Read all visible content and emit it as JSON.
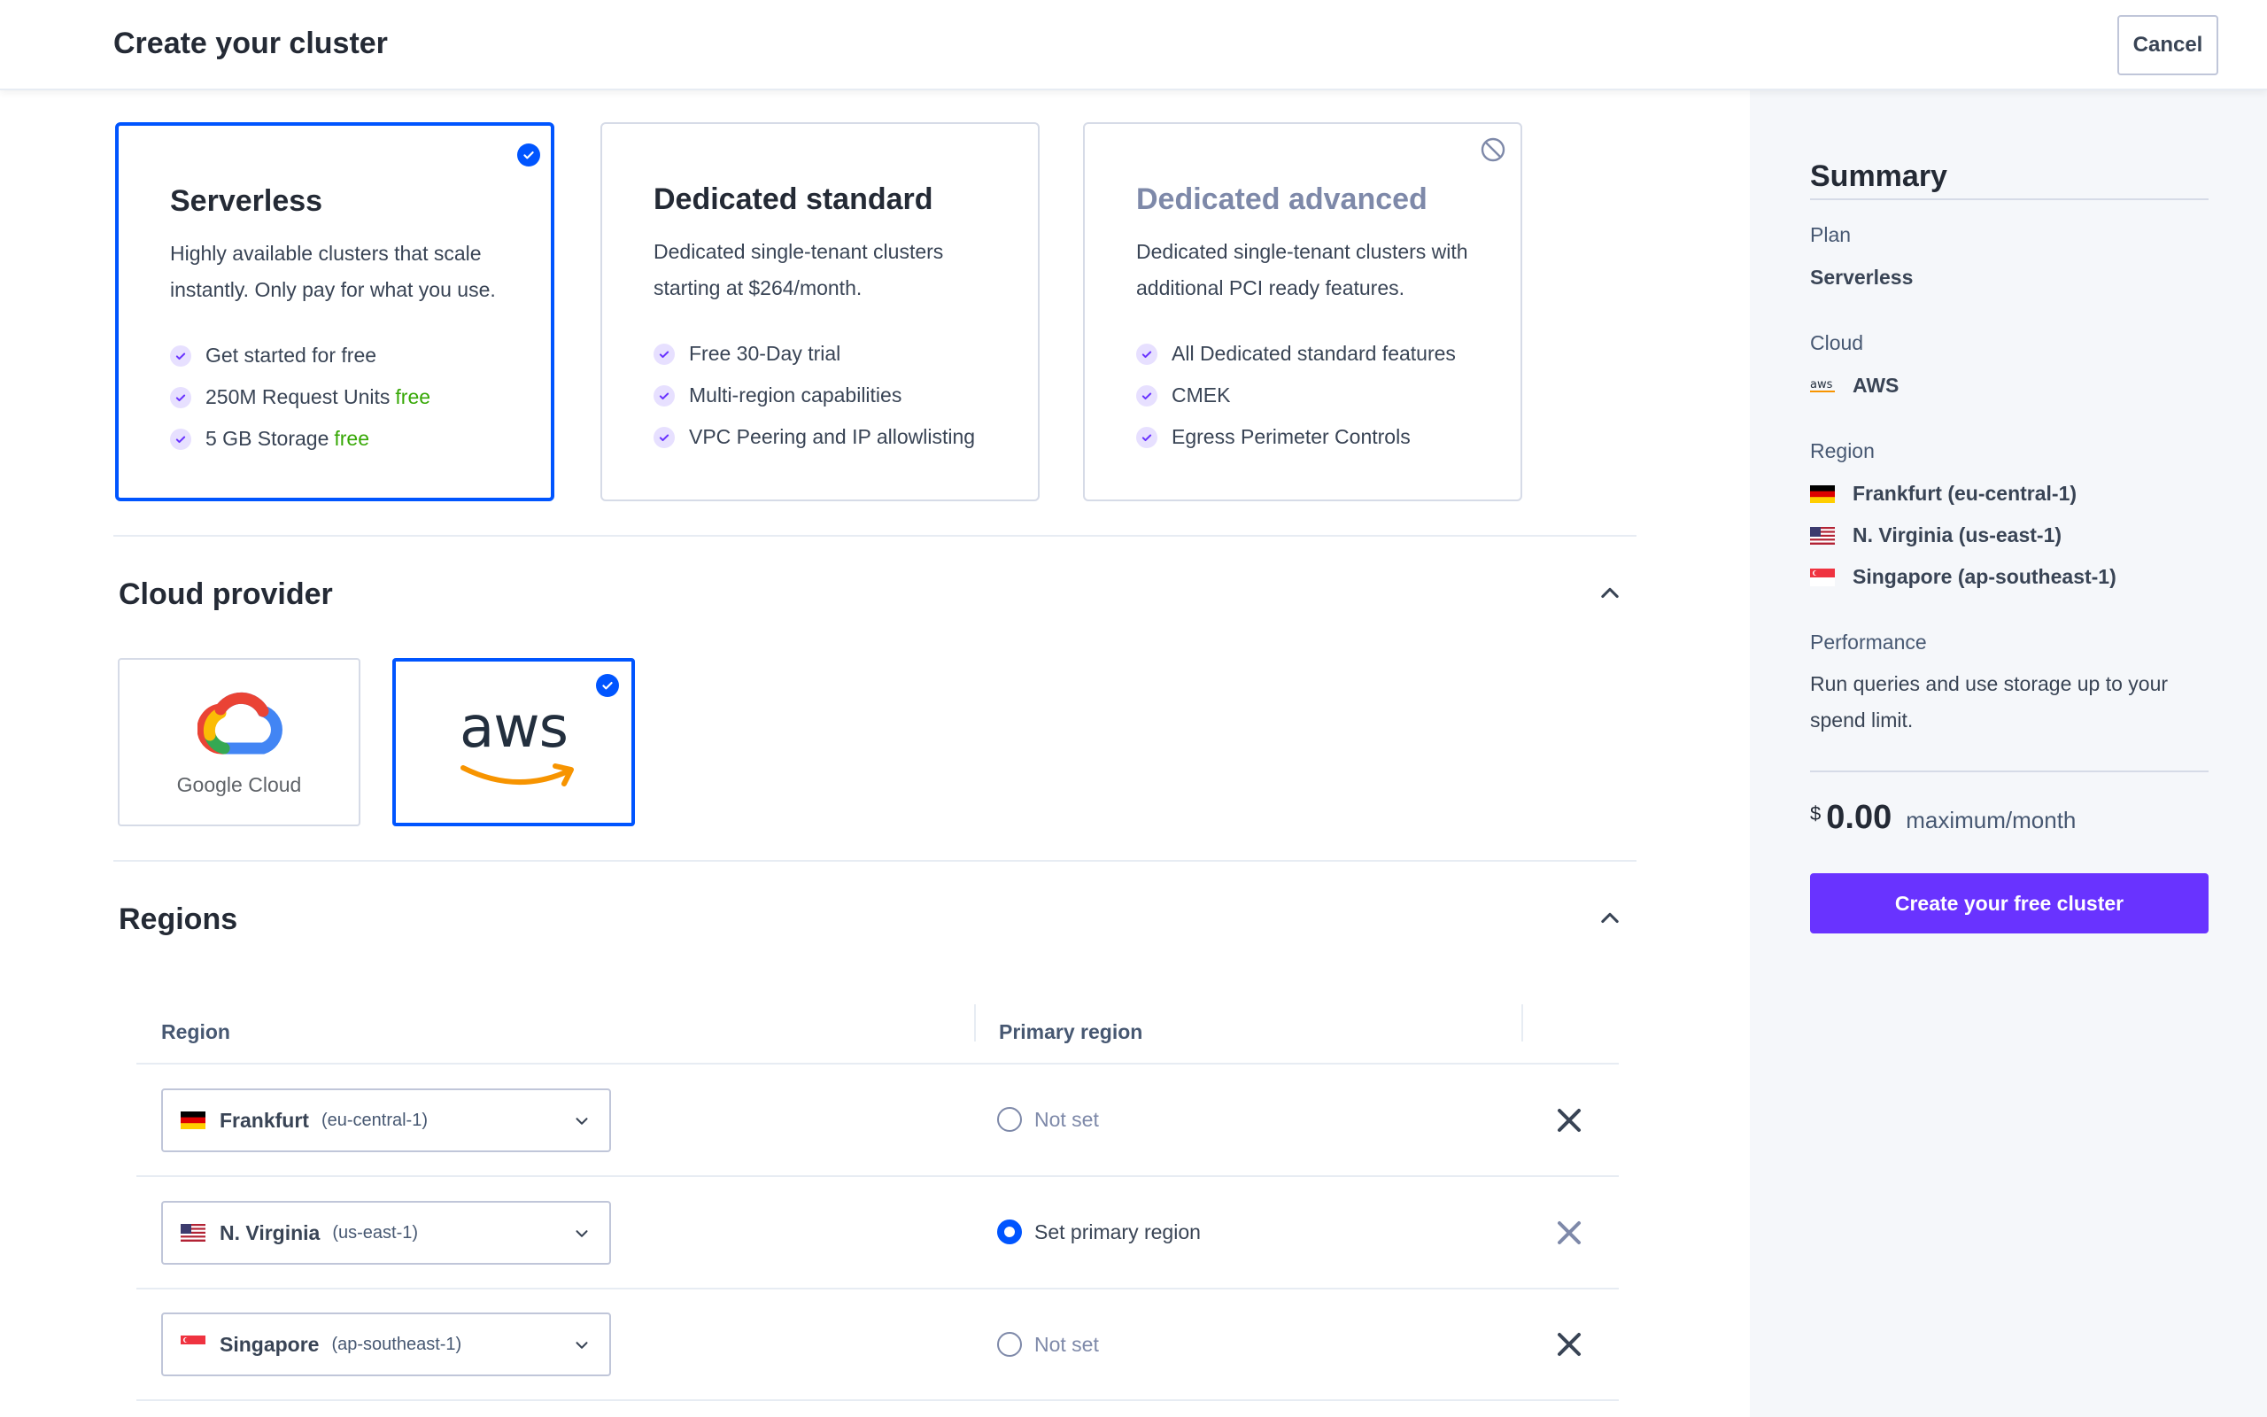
{
  "header": {
    "title": "Create your cluster",
    "cancel_label": "Cancel"
  },
  "plans": [
    {
      "title": "Serverless",
      "description": "Highly available clusters that scale instantly. Only pay for what you use.",
      "features": [
        {
          "text": "Get started for free",
          "highlight": ""
        },
        {
          "text": "250M Request Units",
          "highlight": "free"
        },
        {
          "text": "5 GB Storage",
          "highlight": "free"
        }
      ],
      "state": "selected"
    },
    {
      "title": "Dedicated standard",
      "description": "Dedicated single-tenant clusters starting at $264/month.",
      "features": [
        {
          "text": "Free 30-Day trial",
          "highlight": ""
        },
        {
          "text": "Multi-region capabilities",
          "highlight": ""
        },
        {
          "text": "VPC Peering and IP allowlisting",
          "highlight": ""
        }
      ],
      "state": "available"
    },
    {
      "title": "Dedicated advanced",
      "description": "Dedicated single-tenant clusters with additional PCI ready features.",
      "features": [
        {
          "text": "All Dedicated standard features",
          "highlight": ""
        },
        {
          "text": "CMEK",
          "highlight": ""
        },
        {
          "text": "Egress Perimeter Controls",
          "highlight": ""
        }
      ],
      "state": "disabled"
    }
  ],
  "cloud_provider": {
    "title": "Cloud provider",
    "google": {
      "label": "Google Cloud"
    },
    "aws": {
      "label": "aws",
      "selected": true
    }
  },
  "regions": {
    "title": "Regions",
    "col_region": "Region",
    "col_primary": "Primary region",
    "rows": [
      {
        "name": "Frankfurt",
        "code": "(eu-central-1)",
        "flag": "de",
        "primary_label": "Not set",
        "primary": false
      },
      {
        "name": "N. Virginia",
        "code": "(us-east-1)",
        "flag": "us",
        "primary_label": "Set primary region",
        "primary": true
      },
      {
        "name": "Singapore",
        "code": "(ap-southeast-1)",
        "flag": "sg",
        "primary_label": "Not set",
        "primary": false
      }
    ]
  },
  "summary": {
    "title": "Summary",
    "plan_label": "Plan",
    "plan_value": "Serverless",
    "cloud_label": "Cloud",
    "cloud_icon_text": "aws",
    "cloud_value": "AWS",
    "region_label": "Region",
    "region_values": [
      "Frankfurt (eu-central-1)",
      "N. Virginia (us-east-1)",
      "Singapore (ap-southeast-1)"
    ],
    "performance_label": "Performance",
    "performance_text": "Run queries and use storage up to your spend limit.",
    "currency": "$",
    "price": "0.00",
    "price_period": "maximum/month",
    "cta_label": "Create your free cluster"
  },
  "colors": {
    "accent": "#0055ff",
    "cta": "#6933ff",
    "free": "#37a806",
    "sidebar_bg": "#f5f7fa"
  }
}
